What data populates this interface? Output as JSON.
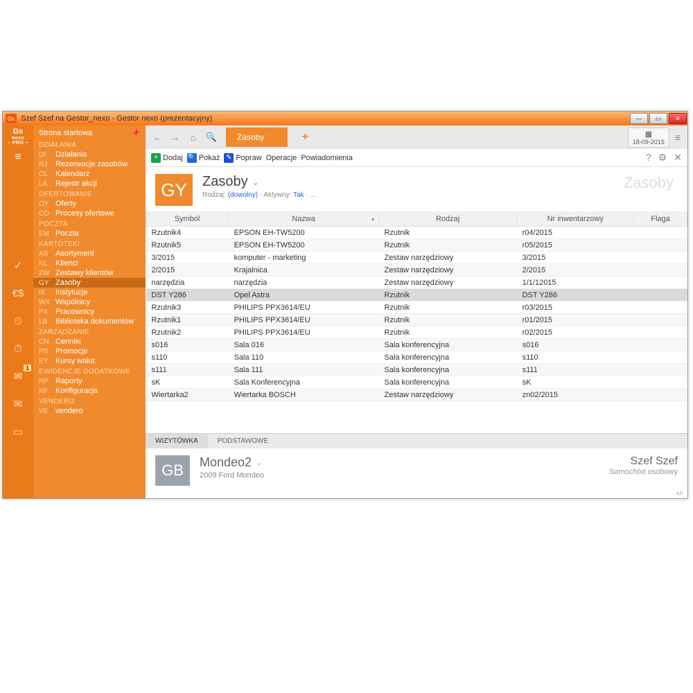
{
  "window": {
    "title": "Szef Szef na Gestor_nexo - Gestor nexo (prezentacyjny)"
  },
  "rail": {
    "logo_top": "Gs",
    "logo_mid": "nexo",
    "logo_bot": "– PRO –",
    "mail_badge": "1"
  },
  "sidebar": {
    "home": "Strona startowa",
    "groups": [
      {
        "cat": "DZIAŁANIA",
        "items": [
          {
            "pf": "DI",
            "t": "Działania"
          },
          {
            "pf": "RJ",
            "t": "Rezerwacje zasobów"
          },
          {
            "pf": "CL",
            "t": "Kalendarz"
          },
          {
            "pf": "LA",
            "t": "Rejestr akcji"
          }
        ]
      },
      {
        "cat": "OFERTOWANIE",
        "items": [
          {
            "pf": "OY",
            "t": "Oferty"
          },
          {
            "pf": "CO",
            "t": "Procesy ofertowe"
          }
        ]
      },
      {
        "cat": "POCZTA",
        "items": [
          {
            "pf": "EM",
            "t": "Poczta"
          }
        ]
      },
      {
        "cat": "KARTOTEKI",
        "items": [
          {
            "pf": "AS",
            "t": "Asortyment"
          },
          {
            "pf": "KL",
            "t": "Klienci"
          },
          {
            "pf": "ZW",
            "t": "Zestawy klientów"
          },
          {
            "pf": "GY",
            "t": "Zasoby",
            "active": true
          },
          {
            "pf": "IX",
            "t": "Instytucje"
          },
          {
            "pf": "WX",
            "t": "Wspólnicy"
          },
          {
            "pf": "PX",
            "t": "Pracownicy"
          },
          {
            "pf": "LB",
            "t": "Biblioteka dokumentów"
          }
        ]
      },
      {
        "cat": "ZARZĄDZANIE",
        "items": [
          {
            "pf": "CN",
            "t": "Cenniki"
          },
          {
            "pf": "PS",
            "t": "Promocje"
          },
          {
            "pf": "EY",
            "t": "Kursy walut"
          }
        ]
      },
      {
        "cat": "EWIDENCJE DODATKOWE",
        "items": [
          {
            "pf": "RP",
            "t": "Raporty"
          },
          {
            "pf": "KF",
            "t": "Konfiguracja"
          }
        ]
      },
      {
        "cat": "VENDERO",
        "items": [
          {
            "pf": "VE",
            "t": "vendero"
          }
        ]
      }
    ]
  },
  "tabbar": {
    "tab": "Zasoby",
    "date": "18-09-2015"
  },
  "toolbar": {
    "add": "Dodaj",
    "show": "Pokaż",
    "edit": "Popraw",
    "ops": "Operacje",
    "notif": "Powiadomienia"
  },
  "pagehead": {
    "tile": "GY",
    "title": "Zasoby",
    "ghost": "Zasoby",
    "sub_pre": "Rodzaj: ",
    "sub_kind": "(dowolny)",
    "sub_mid": " · Aktywny: ",
    "sub_act": "Tak",
    "sub_post": " · ..."
  },
  "columns": [
    "Symbol",
    "Nazwa",
    "Rodzaj",
    "Nr inwentarzowy",
    "Flaga"
  ],
  "rows": [
    {
      "c0": "Rzutnik4",
      "c1": "EPSON EH-TW5200",
      "c2": "Rzutnik",
      "c3": "r04/2015",
      "c4": ""
    },
    {
      "c0": "Rzutnik5",
      "c1": "EPSON EH-TW5200",
      "c2": "Rzutnik",
      "c3": "r05/2015",
      "c4": ""
    },
    {
      "c0": "3/2015",
      "c1": "komputer - marketing",
      "c2": "Zestaw narzędziowy",
      "c3": "3/2015",
      "c4": ""
    },
    {
      "c0": "2/2015",
      "c1": "Krajalnica",
      "c2": "Zestaw narzędziowy",
      "c3": "2/2015",
      "c4": ""
    },
    {
      "c0": "narzędzia",
      "c1": "narzędzia",
      "c2": "Zestaw narzędziowy",
      "c3": "1/1/12015",
      "c4": ""
    },
    {
      "c0": "DST Y286",
      "c1": "Opel Astra",
      "c2": "Rzutnik",
      "c3": "DST Y286",
      "c4": "",
      "sel": true
    },
    {
      "c0": "Rzutnik3",
      "c1": "PHILIPS PPX3614/EU",
      "c2": "Rzutnik",
      "c3": "r03/2015",
      "c4": ""
    },
    {
      "c0": "Rzutnik1",
      "c1": "PHILIPS PPX3614/EU",
      "c2": "Rzutnik",
      "c3": "r01/2015",
      "c4": ""
    },
    {
      "c0": "Rzutnik2",
      "c1": "PHILIPS PPX3614/EU",
      "c2": "Rzutnik",
      "c3": "r02/2015",
      "c4": ""
    },
    {
      "c0": "s016",
      "c1": "Sala 016",
      "c2": "Sala konferencyjna",
      "c3": "s016",
      "c4": ""
    },
    {
      "c0": "s110",
      "c1": "Sala 110",
      "c2": "Sala konferencyjna",
      "c3": "s110",
      "c4": ""
    },
    {
      "c0": "s111",
      "c1": "Sala 111",
      "c2": "Sala konferencyjna",
      "c3": "s111",
      "c4": ""
    },
    {
      "c0": "sK",
      "c1": "Sala Konferencyjna",
      "c2": "Sala konferencyjna",
      "c3": "sK",
      "c4": ""
    },
    {
      "c0": "Wiertarka2",
      "c1": "Wiertarka BOSCH",
      "c2": "Zestaw narzędziowy",
      "c3": "zn02/2015",
      "c4": ""
    }
  ],
  "detailtabs": {
    "t1": "WIZYTÓWKA",
    "t2": "PODSTAWOWE"
  },
  "detail": {
    "tile": "GB",
    "title": "Mondeo2",
    "sub": "2009 Ford Mondeo",
    "owner": "Szef Szef",
    "owner_sub": "Samochód osobowy"
  },
  "pm": "+/-"
}
